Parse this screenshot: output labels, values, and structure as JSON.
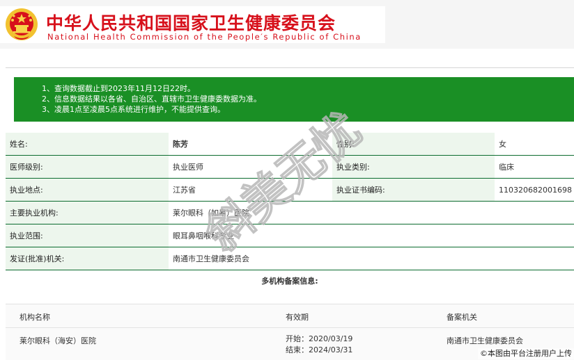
{
  "header": {
    "title_cn": "中华人民共和国国家卫生健康委员会",
    "title_en": "National Health Commission of the People′s Republic of China",
    "logo_icon": "national-emblem-icon",
    "brand_color": "#d7101b"
  },
  "notice": {
    "items": [
      "1、查询数据截止到2023年11月12日22时。",
      "2、信息数据结果以各省、自治区、直辖市卫生健康委数据为准。",
      "3、凌晨1点至凌晨5点系统进行维护，不能提供查询。"
    ],
    "color": "#1a8f25"
  },
  "info": {
    "name_label": "姓名:",
    "name_value": "陈芳",
    "gender_label": "性别:",
    "gender_value": "女",
    "level_label": "医师级别:",
    "level_value": "执业医师",
    "category_label": "执业类别:",
    "category_value": "临床",
    "location_label": "执业地点:",
    "location_value": "江苏省",
    "cert_label": "执业证书编码:",
    "cert_value": "110320682001698",
    "institution_label": "主要执业机构:",
    "institution_value": "莱尔眼科（如皋）医院",
    "scope_label": "执业范围:",
    "scope_value": "眼耳鼻咽喉科专业",
    "issuer_label": "发证(批准)机关:",
    "issuer_value": "南通市卫生健康委员会",
    "multi_title": "多机构备案信息:"
  },
  "multi": {
    "headers": {
      "name": "机构名称",
      "validity": "有效期",
      "authority": "备案机关"
    },
    "rows": [
      {
        "name": "莱尔眼科（海安）医院",
        "start": "开始：2020/03/19",
        "end": "结束：2024/03/31",
        "authority": "南通市卫生健康委员会"
      }
    ]
  },
  "watermark": "斜美无忧",
  "credit": "©本图由平台注册用户上传"
}
